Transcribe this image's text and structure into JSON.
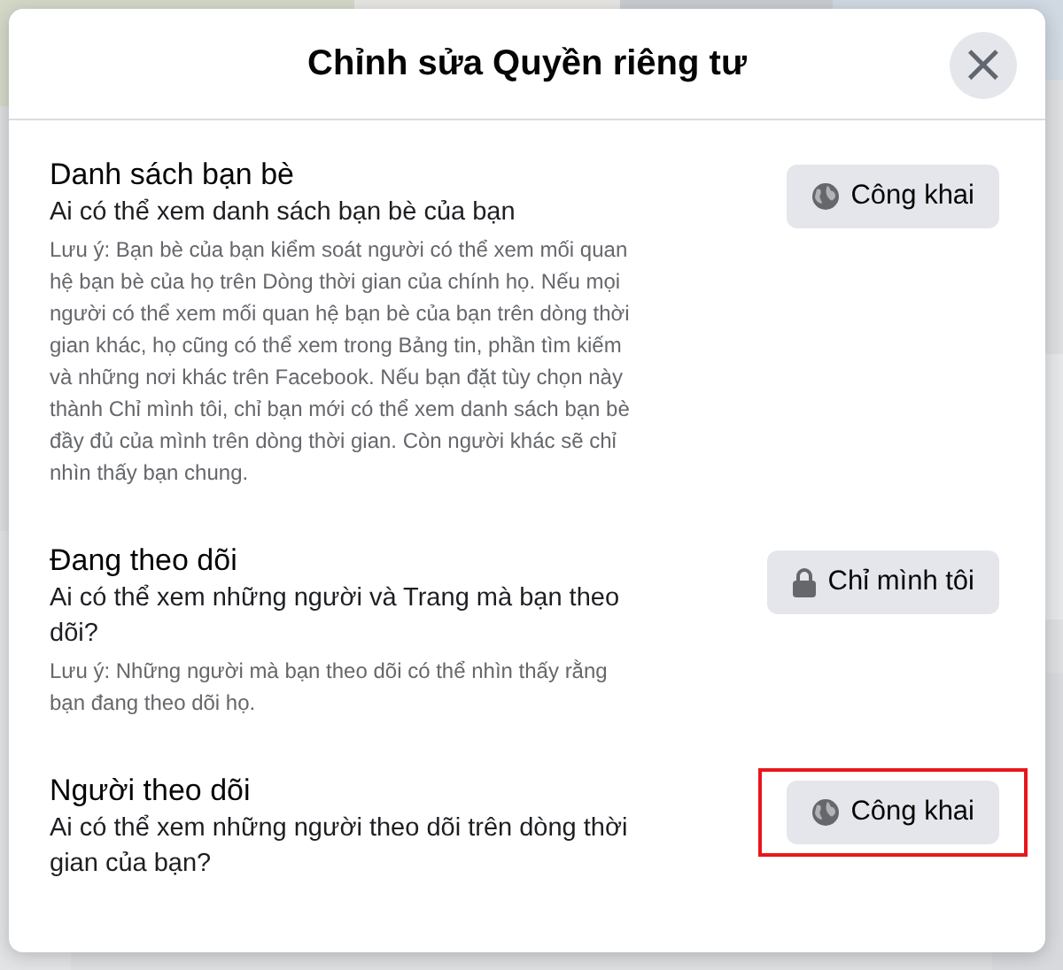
{
  "dialog": {
    "title": "Chỉnh sửa Quyền riêng tư",
    "close": "×"
  },
  "sections": [
    {
      "title": "Danh sách bạn bè",
      "subtitle": "Ai có thể xem danh sách bạn bè của bạn",
      "note": "Lưu ý: Bạn bè của bạn kiểm soát người có thể xem mối quan hệ bạn bè của họ trên Dòng thời gian của chính họ. Nếu mọi người có thể xem mối quan hệ bạn bè của bạn trên dòng thời gian khác, họ cũng có thể xem trong Bảng tin, phần tìm kiếm và những nơi khác trên Facebook. Nếu bạn đặt tùy chọn này thành Chỉ mình tôi, chỉ bạn mới có thể xem danh sách bạn bè đầy đủ của mình trên dòng thời gian. Còn người khác sẽ chỉ nhìn thấy bạn chung.",
      "button": {
        "kind": "public",
        "label": "Công khai",
        "highlighted": false
      }
    },
    {
      "title": "Đang theo dõi",
      "subtitle": "Ai có thể xem những người và Trang mà bạn theo dõi?",
      "note": "Lưu ý: Những người mà bạn theo dõi có thể nhìn thấy rằng bạn đang theo dõi họ.",
      "button": {
        "kind": "only_me",
        "label": "Chỉ mình tôi",
        "highlighted": false
      }
    },
    {
      "title": "Người theo dõi",
      "subtitle": "Ai có thể xem những người theo dõi trên dòng thời gian của bạn?",
      "button": {
        "kind": "public",
        "label": "Công khai",
        "highlighted": true
      }
    }
  ]
}
